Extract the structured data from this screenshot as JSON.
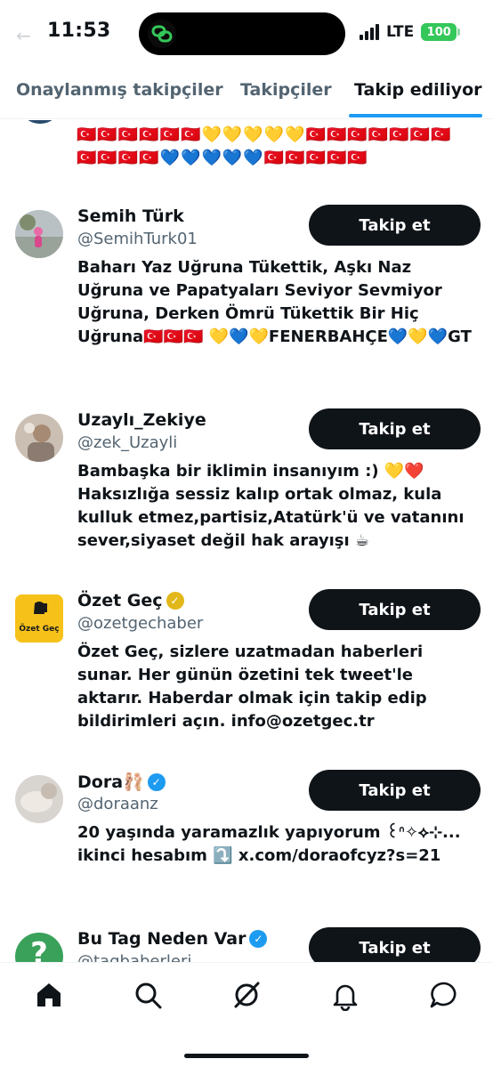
{
  "status_bar": {
    "time": "11:53",
    "network": "LTE",
    "battery": "100"
  },
  "tabs": [
    {
      "label": "Onaylanmış takipçiler",
      "active": false
    },
    {
      "label": "Takipçiler",
      "active": false
    },
    {
      "label": "Takip ediliyor",
      "active": true
    }
  ],
  "partial_bio": {
    "line1": "🇹🇷🇹🇷🇹🇷🇹🇷🇹🇷🇹🇷💛💛💛💛💛🇹🇷🇹🇷🇹🇷🇹🇷🇹🇷🇹🇷🇹🇷",
    "line2": "🇹🇷🇹🇷🇹🇷🇹🇷💙💙💙💙💙🇹🇷🇹🇷🇹🇷🇹🇷🇹🇷"
  },
  "users": [
    {
      "name": "Semih Türk",
      "handle": "@SemihTurk01",
      "verified": "",
      "follow_label": "Takip et",
      "bio": "Baharı Yaz Uğruna Tükettik, Aşkı Naz Uğruna ve Papatyaları Seviyor Sevmiyor Uğruna, Derken Ömrü Tükettik Bir Hiç Uğruna🇹🇷🇹🇷🇹🇷 💛💙💛FENERBAHÇE💙💛💙GT"
    },
    {
      "name": "Uzaylı_Zekiye",
      "handle": "@zek_Uzayli",
      "verified": "",
      "follow_label": "Takip et",
      "bio": "Bambaşka bir iklimin insanıyım :) 💛❤️ Haksızlığa sessiz kalıp ortak olmaz, kula kulluk etmez,partisiz,Atatürk'ü ve vatanını sever,siyaset değil hak arayışı ☕"
    },
    {
      "name": "Özet Geç",
      "handle": "@ozetgechaber",
      "verified": "gold",
      "follow_label": "Takip et",
      "avatar_text": "Özet Geç",
      "bio": "Özet Geç, sizlere uzatmadan haberleri sunar. Her günün özetini tek tweet'le aktarır. Haberdar olmak için takip edip bildirimleri açın. info@ozetgec.tr"
    },
    {
      "name": "Dora🩰",
      "handle": "@doraanz",
      "verified": "blue",
      "follow_label": "Takip et",
      "bio": "20 yaşında yaramazlık yapıyorum ꒰ᐢ✧⟡⊹... ikinci hesabım ⤵️ x.com/doraofcyz?s=21"
    },
    {
      "name": "Bu Tag Neden Var",
      "handle": "@tagbaberleri",
      "verified": "blue",
      "follow_label": "Takip et",
      "avatar_text": "?",
      "bio": ""
    }
  ],
  "nav": [
    {
      "icon": "home-icon"
    },
    {
      "icon": "search-icon"
    },
    {
      "icon": "grok-icon"
    },
    {
      "icon": "bell-icon"
    },
    {
      "icon": "messages-icon"
    }
  ],
  "colors": {
    "accent": "#1d9bf0",
    "button_bg": "#0f1419",
    "muted": "#536471",
    "gold": "#e2b719"
  }
}
